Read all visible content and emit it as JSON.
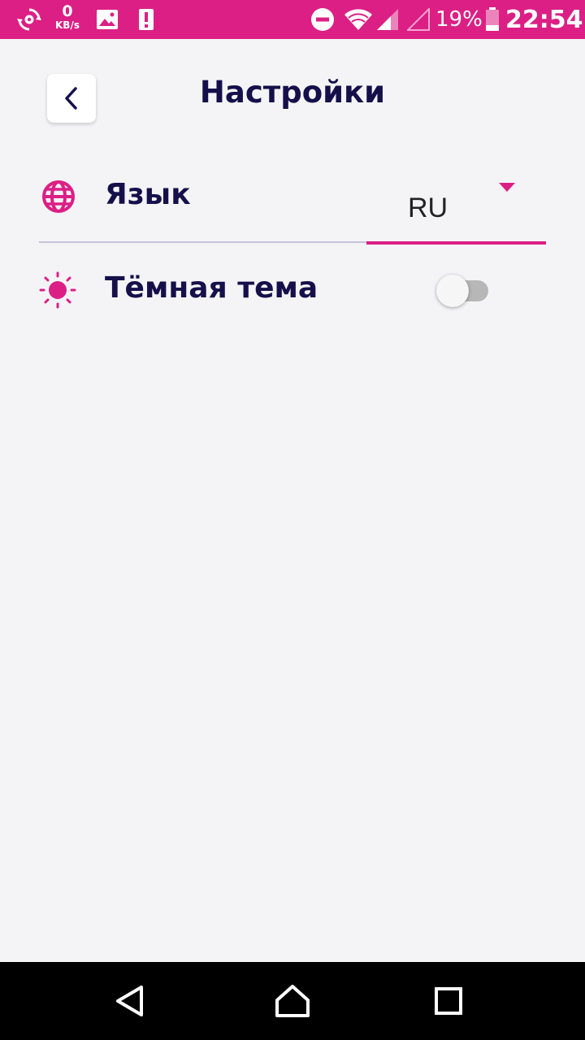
{
  "status_bar": {
    "net_speed_value": "0",
    "net_speed_unit": "KB/s",
    "battery_percent": "19%",
    "time": "22:54",
    "icons": [
      "sync-settings-icon",
      "image-icon",
      "alert-icon",
      "do-not-disturb-icon",
      "wifi-icon",
      "cell-signal-icon",
      "no-signal-icon",
      "battery-icon"
    ]
  },
  "header": {
    "title": "Настройки",
    "back_icon": "chevron-left-icon"
  },
  "settings": {
    "language": {
      "label": "Язык",
      "icon": "globe-icon",
      "selected": "RU"
    },
    "dark_theme": {
      "label": "Тёмная тема",
      "icon": "sun-icon",
      "enabled": false
    }
  },
  "nav_bar": {
    "icons": [
      "back-triangle-icon",
      "home-icon",
      "recents-icon"
    ]
  },
  "colors": {
    "accent": "#dc1f85",
    "title_text": "#15104a",
    "background": "#f4f4f6"
  }
}
